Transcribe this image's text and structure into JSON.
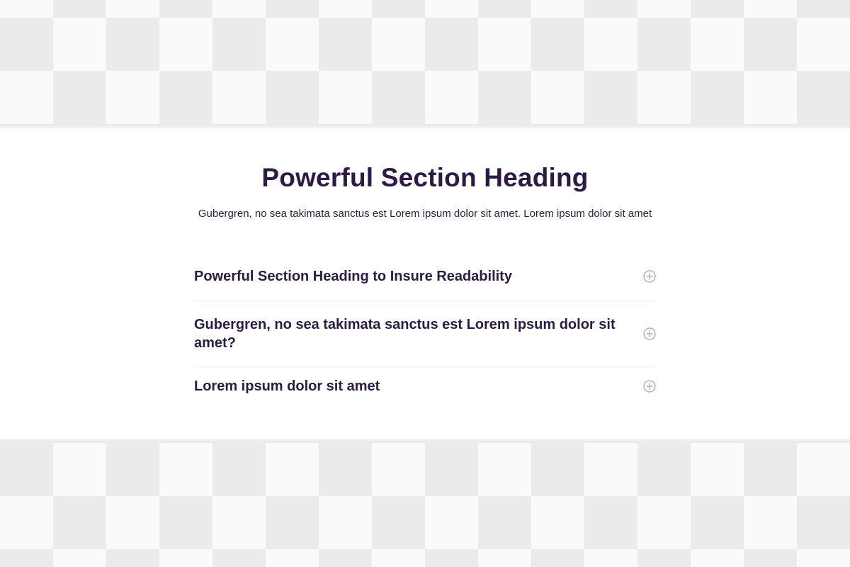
{
  "section": {
    "title": "Powerful Section Heading",
    "subtitle": "Gubergren, no sea takimata sanctus est Lorem ipsum dolor sit amet. Lorem ipsum dolor sit amet"
  },
  "faq": {
    "items": [
      {
        "question": "Powerful Section Heading to Insure Readability",
        "icon": "plus-circle-icon"
      },
      {
        "question": "Gubergren, no sea takimata sanctus est Lorem ipsum dolor sit amet?",
        "icon": "plus-circle-icon"
      },
      {
        "question": "Lorem ipsum dolor sit amet",
        "icon": "plus-circle-icon"
      }
    ]
  },
  "colors": {
    "text": "#2c1b47",
    "icon": "#a5a5b0",
    "divider": "#ececec",
    "panel": "#ffffff"
  }
}
